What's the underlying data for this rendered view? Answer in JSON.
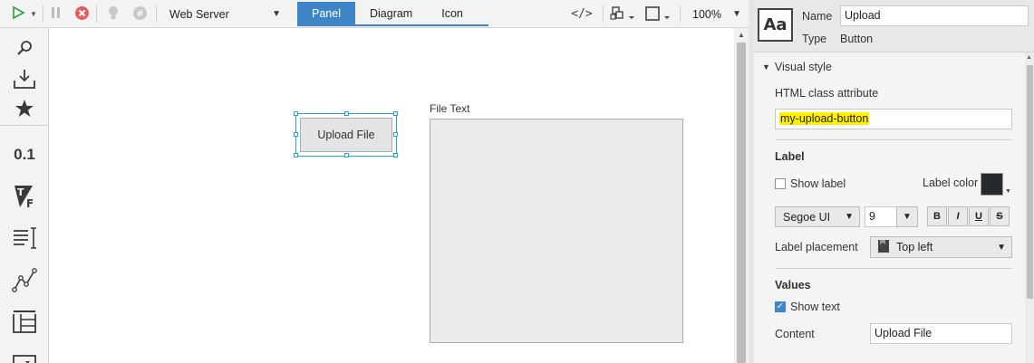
{
  "toolbar": {
    "run_icon": "play-icon",
    "pause_icon": "pause-icon",
    "stop_icon": "stop-icon",
    "hint_icon": "lightbulb-icon",
    "hash_icon": "hash-icon",
    "server_select": "Web Server",
    "tabs": [
      {
        "label": "Panel",
        "active": true
      },
      {
        "label": "Diagram",
        "active": false
      },
      {
        "label": "Icon",
        "active": false
      }
    ],
    "code_label": "</>",
    "zoom": "100%"
  },
  "palette": {
    "items": [
      "search-icon",
      "import-icon",
      "favorite-star-icon",
      "numeric-display-icon",
      "text-format-icon",
      "text-list-icon",
      "line-chart-icon",
      "table-icon",
      "combo-box-icon"
    ],
    "numeric_label": "0.1"
  },
  "canvas": {
    "upload_button_label": "Upload File",
    "file_text_label": "File Text"
  },
  "properties": {
    "name_label": "Name",
    "name_value": "Upload",
    "type_label": "Type",
    "type_value": "Button",
    "visual_style": "Visual style",
    "html_class_label": "HTML class attribute",
    "html_class_value": "my-upload-button",
    "label_section": "Label",
    "show_label": "Show label",
    "show_label_checked": false,
    "label_color_label": "Label color",
    "label_color": "#262a2d",
    "font_family": "Segoe UI",
    "font_size": "9",
    "format_buttons": [
      "B",
      "I",
      "U",
      "S"
    ],
    "label_placement_label": "Label placement",
    "label_placement_value": "Top left",
    "values_section": "Values",
    "show_text": "Show text",
    "show_text_checked": true,
    "content_label": "Content",
    "content_value": "Upload File"
  },
  "colors": {
    "accent": "#3d85c6",
    "selection": "#2aa4c8",
    "highlight": "#fff000"
  }
}
